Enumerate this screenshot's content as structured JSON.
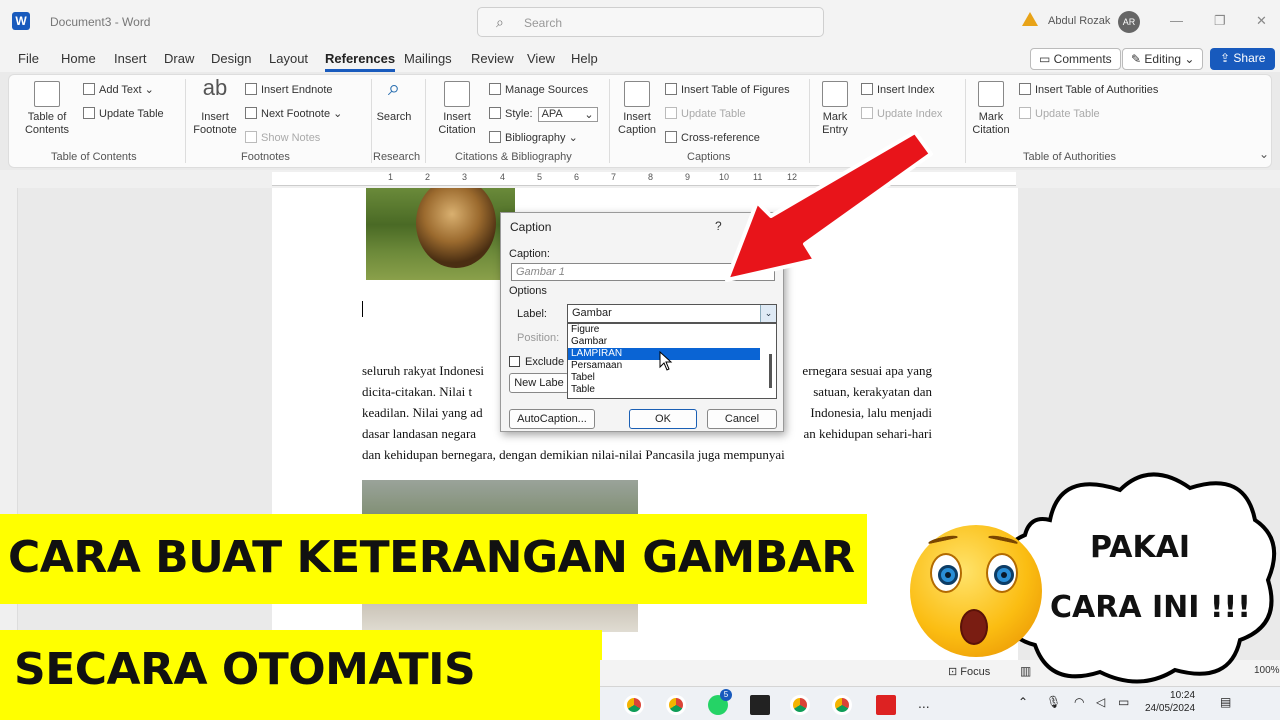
{
  "titlebar": {
    "app_icon": "W",
    "doc_title": "Document3  -  Word",
    "search_placeholder": "Search",
    "user_name": "Abdul Rozak",
    "avatar_initials": "AR"
  },
  "menu": {
    "tabs": [
      "File",
      "Home",
      "Insert",
      "Draw",
      "Design",
      "Layout",
      "References",
      "Mailings",
      "Review",
      "View",
      "Help"
    ],
    "active_tab": "References",
    "comments": "Comments",
    "editing": "Editing",
    "share": "Share"
  },
  "ribbon": {
    "toc_big": "Table of\nContents",
    "add_text": "Add Text",
    "update_table": "Update Table",
    "group_toc": "Table of Contents",
    "insert_footnote": "Insert\nFootnote",
    "insert_endnote": "Insert Endnote",
    "next_footnote": "Next Footnote",
    "show_notes": "Show Notes",
    "group_footnotes": "Footnotes",
    "search": "Search",
    "group_research": "Research",
    "insert_citation": "Insert\nCitation",
    "manage_sources": "Manage Sources",
    "style_label": "Style:",
    "style_value": "APA",
    "bibliography": "Bibliography",
    "group_citations": "Citations & Bibliography",
    "insert_caption": "Insert\nCaption",
    "insert_tof": "Insert Table of Figures",
    "update_table2": "Update Table",
    "cross_reference": "Cross-reference",
    "group_captions": "Captions",
    "mark_entry": "Mark\nEntry",
    "insert_index": "Insert Index",
    "update_index": "Update Index",
    "mark_citation": "Mark\nCitation",
    "insert_toa": "Insert Table of Authorities",
    "update_table3": "Update Table",
    "group_toa": "Table of Authorities",
    "abc_icon": "ab"
  },
  "ruler": {
    "numbers": [
      "1",
      "2",
      "3",
      "4",
      "5",
      "6",
      "7",
      "8",
      "9",
      "10",
      "11",
      "12"
    ]
  },
  "document": {
    "paragraph_lines": [
      "seluruh rakyat Indonesi",
      "dicita-citakan. Nilai t",
      "keadilan. Nilai yang ad",
      "dasar landasan negara",
      "dan kehidupan bernegara, dengan demikian nilai-nilai Pancasila juga mempunyai"
    ],
    "right_fragments": [
      "ernegara sesuai apa yang",
      "satuan, kerakyatan dan",
      "Indonesia, lalu menjadi",
      "an kehidupan sehari-hari"
    ]
  },
  "dialog": {
    "title": "Caption",
    "help": "?",
    "caption_label": "Caption:",
    "caption_value": "Gambar 1",
    "options_label": "Options",
    "label_label": "Label:",
    "label_value": "Gambar",
    "position_label": "Position:",
    "exclude_label": "Exclude l",
    "new_label_btn": "New Labe",
    "label_options": [
      "Figure",
      "Gambar",
      "LAMPIRAN",
      "Persamaan",
      "Tabel",
      "Table"
    ],
    "selected_option": "LAMPIRAN",
    "autocaption_btn": "AutoCaption...",
    "ok_btn": "OK",
    "cancel_btn": "Cancel"
  },
  "banners": {
    "line1": "CARA BUAT KETERANGAN GAMBAR",
    "line2": "SECARA OTOMATIS"
  },
  "bubble": {
    "line1": "PAKAI",
    "line2": "CARA INI !!!"
  },
  "statusbar": {
    "focus": "Focus",
    "zoom": "100%"
  },
  "taskbar": {
    "time": "10:24",
    "date": "24/05/2024",
    "whatsapp_badge": "5",
    "more": "..."
  },
  "colors": {
    "word_blue": "#185abd",
    "banner_yellow": "#ffff00",
    "arrow_red": "#e8141a",
    "selection_blue": "#0a64d4"
  }
}
